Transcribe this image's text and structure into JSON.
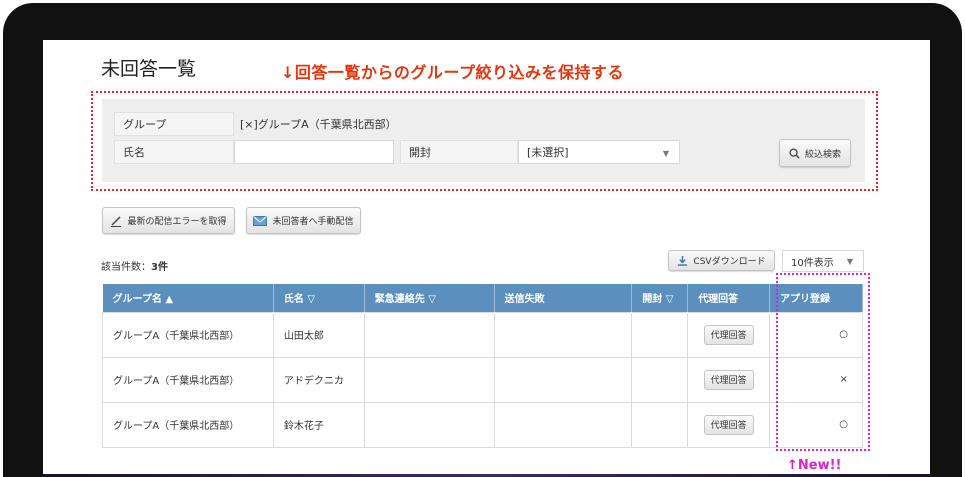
{
  "page": {
    "title": "未回答一覧",
    "annotation_top": "↓回答一覧からのグループ絞り込みを保持する",
    "annotation_new": "↑New!!"
  },
  "filter": {
    "group_label": "グループ",
    "group_value": "[×]グループA（千葉県北西部）",
    "name_label": "氏名",
    "name_value": "",
    "open_label": "開封",
    "open_value": "[未選択]",
    "search_button": "絞込検索"
  },
  "actions": {
    "latest_error_button": "最新の配信エラーを取得",
    "manual_send_button": "未回答者へ手動配信",
    "csv_button": "CSVダウンロード",
    "per_page": "10件表示"
  },
  "results": {
    "count_prefix": "該当件数：",
    "count_value": "3件",
    "columns": [
      "グループ名 ▲",
      "氏名 ▽",
      "緊急連絡先 ▽",
      "送信失敗",
      "開封 ▽",
      "代理回答",
      "アプリ登録"
    ],
    "rows": [
      {
        "group": "グループA（千葉県北西部）",
        "name": "山田太郎",
        "contact": "",
        "failed": "",
        "opened": "",
        "proxy": "代理回答",
        "app": "○"
      },
      {
        "group": "グループA（千葉県北西部）",
        "name": "アドデクニカ",
        "contact": "",
        "failed": "",
        "opened": "",
        "proxy": "代理回答",
        "app": "×"
      },
      {
        "group": "グループA（千葉県北西部）",
        "name": "鈴木花子",
        "contact": "",
        "failed": "",
        "opened": "",
        "proxy": "代理回答",
        "app": "○"
      }
    ]
  },
  "colors": {
    "header_blue": "#5b8fbd",
    "annotation_red": "#e8340c",
    "annotation_magenta": "#e020d0"
  }
}
